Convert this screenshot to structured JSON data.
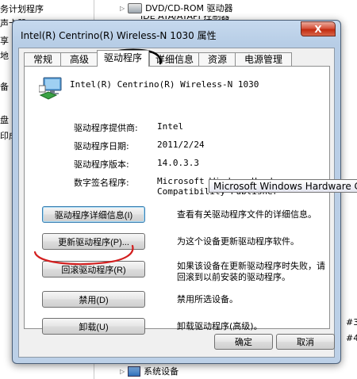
{
  "background": {
    "left_fragments": [
      "务计划程序",
      "声卡器",
      "享",
      "地",
      "备",
      "盘",
      "印成"
    ],
    "right_items": {
      "dvd_drive": "DVD/CD-ROM 驱动器",
      "ide_controllers": "IDE ATA/ATAPI 控制器",
      "system_devices": "系统设备",
      "frag_3": "#3",
      "frag_4": "#4"
    }
  },
  "dialog": {
    "title": "Intel(R) Centrino(R) Wireless-N 1030 属性",
    "close_symbol": "X",
    "tabs": [
      {
        "label": "常规",
        "active": false
      },
      {
        "label": "高级",
        "active": false
      },
      {
        "label": "驱动程序",
        "active": true
      },
      {
        "label": "详细信息",
        "active": false
      },
      {
        "label": "资源",
        "active": false
      },
      {
        "label": "电源管理",
        "active": false
      }
    ],
    "device_name": "Intel(R) Centrino(R) Wireless-N 1030",
    "properties": [
      {
        "label": "驱动程序提供商:",
        "value": "Intel"
      },
      {
        "label": "驱动程序日期:",
        "value": "2011/2/24"
      },
      {
        "label": "驱动程序版本:",
        "value": "14.0.3.3"
      },
      {
        "label": "数字签名程序:",
        "value": "Microsoft Windows Hardware",
        "value2": "Compatibility Publisher"
      }
    ],
    "actions": [
      {
        "label": "驱动程序详细信息(I)",
        "desc": "查看有关驱动程序文件的详细信息。"
      },
      {
        "label": "更新驱动程序(P)...",
        "desc": "为这个设备更新驱动程序软件。"
      },
      {
        "label": "回滚驱动程序(R)",
        "desc": "如果该设备在更新驱动程序时失败，请回滚到以前安装的驱动程序。"
      },
      {
        "label": "禁用(D)",
        "desc": "禁用所选设备。"
      },
      {
        "label": "卸载(U)",
        "desc": "卸载驱动程序(高级)。"
      }
    ],
    "ok_label": "确定",
    "cancel_label": "取消",
    "tooltip": "Microsoft Windows Hardware Compatibility Publisher"
  },
  "colors": {
    "annotation_ink": "#d31f1f",
    "tab_mark_ink": "#000000",
    "title_glass": "#b7cde6",
    "close_red": "#c22b10"
  }
}
